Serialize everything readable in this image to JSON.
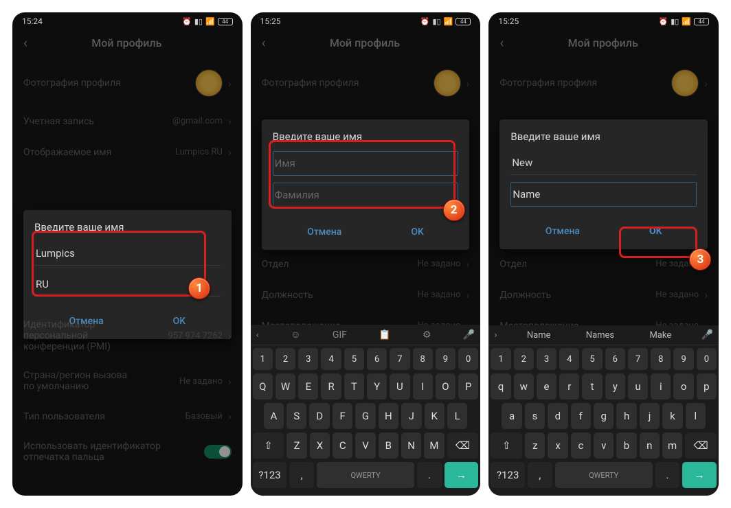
{
  "status": {
    "alarm_icon": "⏰",
    "wifi_icon": "📶",
    "sig_icon": "▮▯",
    "bat_icon": "44"
  },
  "common": {
    "header_title": "Мой профиль",
    "dialog_title": "Введите ваше имя",
    "cancel": "Отмена",
    "ok": "OK",
    "rows": {
      "photo": "Фотография профиля",
      "account": "Учетная запись",
      "account_val": "@gmail.com",
      "display_name": "Отображаемое имя",
      "display_name_val": "Lumpics RU",
      "dept": "Отдел",
      "dept_val": "Не задано",
      "role": "Должность",
      "role_val": "Не задано",
      "loc": "Местоположение",
      "loc_val": "Не задано",
      "pmi": "Идентификатор персональной конференции (PMI)",
      "pmi_val": "957 974 7262",
      "region": "Страна/регион вызова по умолчанию",
      "region_val": "Не задано",
      "utype": "Тип пользователя",
      "utype_val": "Базовый",
      "fprint": "Использовать идентификатор отпечатка пальца"
    }
  },
  "s1": {
    "time": "15:24",
    "first": "Lumpics",
    "last": "RU",
    "marker": "1"
  },
  "s2": {
    "time": "15:25",
    "first_ph": "Имя",
    "last_ph": "Фамилия",
    "first": "",
    "last": "",
    "marker": "2"
  },
  "s3": {
    "time": "15:25",
    "first": "New",
    "last": "Name",
    "marker": "3"
  },
  "kb": {
    "qwerty_label": "QWERTY",
    "sym": "?123",
    "sug_icons": [
      "☺",
      "GIF",
      "📋",
      "⚙",
      "🎤"
    ],
    "s3_sugs": [
      "Name",
      "Names",
      "Make"
    ],
    "row_num": [
      "1",
      "2",
      "3",
      "4",
      "5",
      "6",
      "7",
      "8",
      "9",
      "0"
    ],
    "row1u": [
      "Q",
      "W",
      "E",
      "R",
      "T",
      "Y",
      "U",
      "I",
      "O",
      "P"
    ],
    "row2u": [
      "A",
      "S",
      "D",
      "F",
      "G",
      "H",
      "J",
      "K",
      "L"
    ],
    "row3u": [
      "Z",
      "X",
      "C",
      "V",
      "B",
      "N",
      "M"
    ],
    "row1l": [
      "q",
      "w",
      "e",
      "r",
      "t",
      "y",
      "u",
      "i",
      "o",
      "p"
    ],
    "row2l": [
      "a",
      "s",
      "d",
      "f",
      "g",
      "h",
      "j",
      "k",
      "l"
    ],
    "row3l": [
      "z",
      "x",
      "c",
      "v",
      "b",
      "n",
      "m"
    ]
  }
}
